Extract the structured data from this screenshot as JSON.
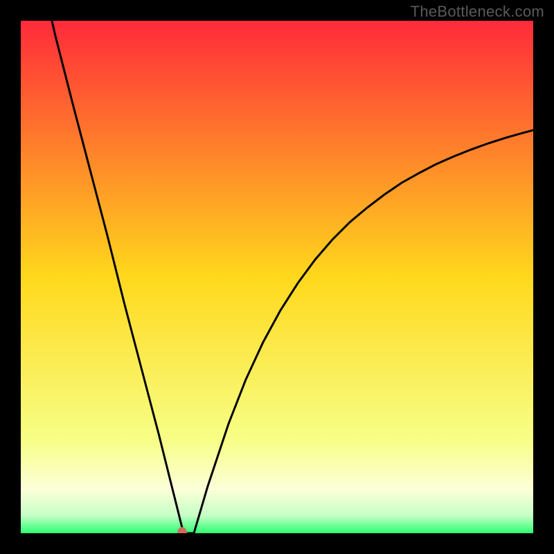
{
  "watermark": "TheBottleneck.com",
  "chart_data": {
    "type": "line",
    "title": "",
    "xlabel": "",
    "ylabel": "",
    "xlim": [
      0,
      100
    ],
    "ylim": [
      0,
      100
    ],
    "grid": false,
    "legend": false,
    "background_gradient": {
      "stops": [
        {
          "offset": 0.0,
          "color": "#ff2a3a"
        },
        {
          "offset": 0.5,
          "color": "#ffd81c"
        },
        {
          "offset": 0.82,
          "color": "#f7ff87"
        },
        {
          "offset": 0.915,
          "color": "#fcffd9"
        },
        {
          "offset": 0.965,
          "color": "#c7ffc7"
        },
        {
          "offset": 1.0,
          "color": "#2cff71"
        }
      ]
    },
    "marker": {
      "x": 31.5,
      "y": 0,
      "color": "#cf6a5e"
    },
    "series": [
      {
        "name": "curve",
        "color": "#000000",
        "x": [
          6.08,
          6.76,
          10.14,
          13.51,
          16.89,
          20.27,
          23.65,
          27.03,
          27.7,
          28.38,
          29.05,
          29.73,
          30.41,
          31.08,
          31.76,
          33.78,
          36.49,
          40.54,
          43.92,
          47.3,
          50.68,
          54.05,
          57.43,
          60.81,
          64.19,
          67.57,
          70.95,
          74.32,
          77.7,
          81.08,
          84.46,
          87.84,
          91.22,
          94.59,
          97.97,
          100.0
        ],
        "y": [
          100.0,
          97.03,
          83.78,
          70.95,
          58.11,
          44.59,
          31.76,
          18.92,
          16.22,
          13.51,
          10.81,
          8.11,
          5.41,
          2.7,
          0.0,
          0.0,
          9.19,
          21.35,
          30.0,
          37.3,
          43.51,
          48.78,
          53.38,
          57.3,
          60.68,
          63.51,
          66.08,
          68.38,
          70.27,
          72.03,
          73.51,
          74.86,
          76.08,
          77.16,
          78.11,
          78.65
        ]
      }
    ]
  }
}
